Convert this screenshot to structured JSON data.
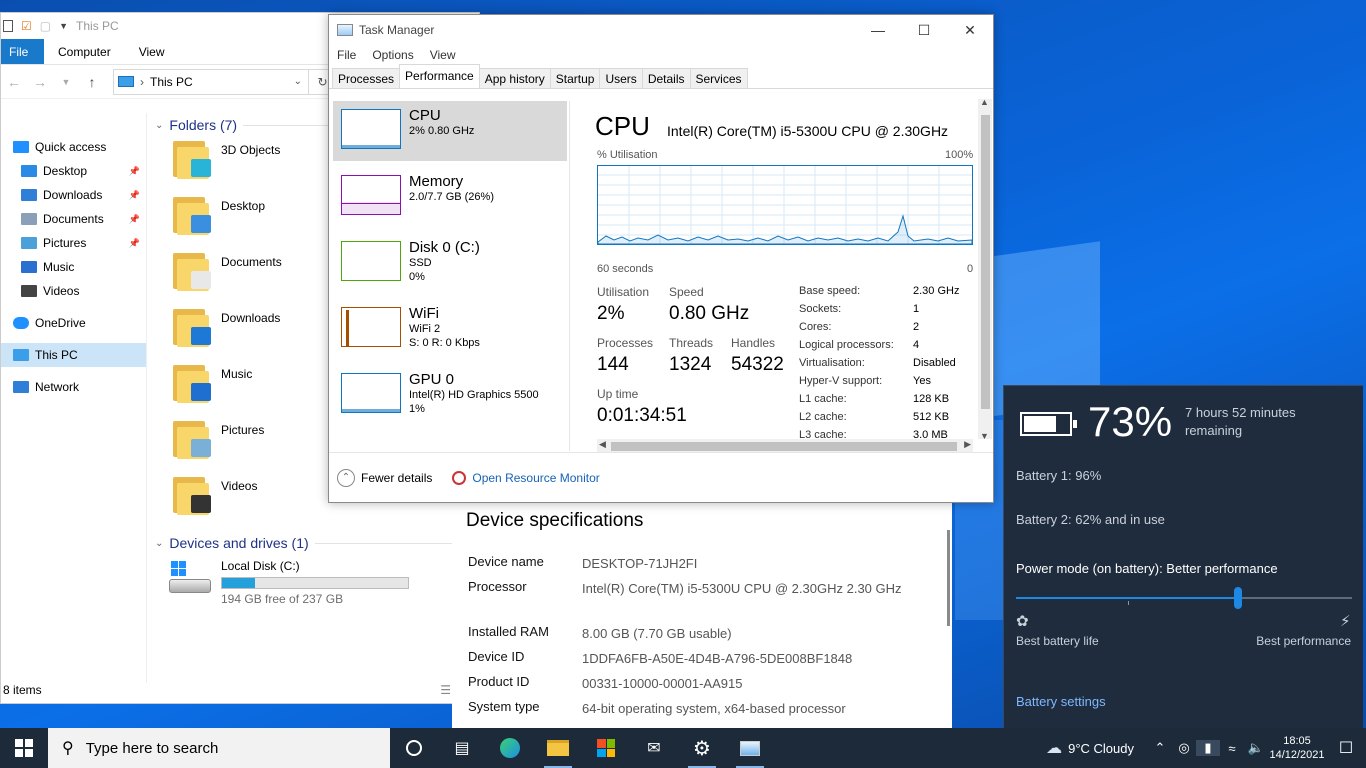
{
  "explorer": {
    "title": "This PC",
    "ribbon": {
      "file": "File",
      "computer": "Computer",
      "view": "View"
    },
    "address": "This PC",
    "nav": [
      {
        "label": "Quick access",
        "icon": "star-icon",
        "level": 0
      },
      {
        "label": "Desktop",
        "icon": "desktop-icon",
        "level": 1,
        "pinned": true
      },
      {
        "label": "Downloads",
        "icon": "downloads-icon",
        "level": 1,
        "pinned": true
      },
      {
        "label": "Documents",
        "icon": "documents-icon",
        "level": 1,
        "pinned": true
      },
      {
        "label": "Pictures",
        "icon": "pictures-icon",
        "level": 1,
        "pinned": true
      },
      {
        "label": "Music",
        "icon": "music-icon",
        "level": 1
      },
      {
        "label": "Videos",
        "icon": "videos-icon",
        "level": 1
      },
      {
        "label": "OneDrive",
        "icon": "cloud-icon",
        "level": 0
      },
      {
        "label": "This PC",
        "icon": "computer-icon",
        "level": 0,
        "selected": true
      },
      {
        "label": "Network",
        "icon": "network-icon",
        "level": 0
      }
    ],
    "folders_header": "Folders (7)",
    "folders": [
      "3D Objects",
      "Desktop",
      "Documents",
      "Downloads",
      "Music",
      "Pictures",
      "Videos"
    ],
    "drives_header": "Devices and drives (1)",
    "drive": {
      "name": "Local Disk (C:)",
      "free": "194 GB free of 237 GB",
      "used_fraction": 0.18
    },
    "status": "8 items"
  },
  "about": {
    "heading": "Device specifications",
    "rows": [
      {
        "k": "Device name",
        "v": "DESKTOP-71JH2FI"
      },
      {
        "k": "Processor",
        "v": "Intel(R) Core(TM) i5-5300U CPU @ 2.30GHz   2.30 GHz"
      },
      {
        "k": "Installed RAM",
        "v": "8.00 GB (7.70 GB usable)"
      },
      {
        "k": "Device ID",
        "v": "1DDFA6FB-A50E-4D4B-A796-5DE008BF1848"
      },
      {
        "k": "Product ID",
        "v": "00331-10000-00001-AA915"
      },
      {
        "k": "System type",
        "v": "64-bit operating system, x64-based processor"
      }
    ]
  },
  "taskmgr": {
    "title": "Task Manager",
    "menu": [
      "File",
      "Options",
      "View"
    ],
    "tabs": [
      "Processes",
      "Performance",
      "App history",
      "Startup",
      "Users",
      "Details",
      "Services"
    ],
    "perf_items": [
      {
        "name": "CPU",
        "l1": "2%  0.80 GHz",
        "l2": "",
        "l3": ""
      },
      {
        "name": "Memory",
        "l1": "2.0/7.7 GB (26%)",
        "l2": "",
        "l3": ""
      },
      {
        "name": "Disk 0 (C:)",
        "l1": "SSD",
        "l2": "0%",
        "l3": ""
      },
      {
        "name": "WiFi",
        "l1": "WiFi 2",
        "l2": "S: 0  R: 0 Kbps",
        "l3": ""
      },
      {
        "name": "GPU 0",
        "l1": "Intel(R) HD Graphics 5500",
        "l2": "1%",
        "l3": ""
      }
    ],
    "cpu": {
      "heading": "CPU",
      "model": "Intel(R) Core(TM) i5-5300U CPU @ 2.30GHz",
      "util_label": "% Utilisation",
      "util_max": "100%",
      "time_label": "60 seconds",
      "time_min": "0",
      "utilisation_label": "Utilisation",
      "utilisation": "2%",
      "speed_label": "Speed",
      "speed": "0.80 GHz",
      "processes_label": "Processes",
      "processes": "144",
      "threads_label": "Threads",
      "threads": "1324",
      "handles_label": "Handles",
      "handles": "54322",
      "uptime_label": "Up time",
      "uptime": "0:01:34:51",
      "specs": [
        {
          "k": "Base speed:",
          "v": "2.30 GHz"
        },
        {
          "k": "Sockets:",
          "v": "1"
        },
        {
          "k": "Cores:",
          "v": "2"
        },
        {
          "k": "Logical processors:",
          "v": "4"
        },
        {
          "k": "Virtualisation:",
          "v": "Disabled"
        },
        {
          "k": "Hyper-V support:",
          "v": "Yes"
        },
        {
          "k": "L1 cache:",
          "v": "128 KB"
        },
        {
          "k": "L2 cache:",
          "v": "512 KB"
        },
        {
          "k": "L3 cache:",
          "v": "3.0 MB"
        }
      ]
    },
    "footer": {
      "fewer": "Fewer details",
      "monitor": "Open Resource Monitor"
    },
    "colors": {
      "cpu": "#1176c2",
      "memory": "#8b12ae",
      "disk": "#4da60c",
      "wifi": "#a74f01",
      "gpu": "#1176c2"
    }
  },
  "battery": {
    "percent": "73%",
    "remaining": "7 hours 52 minutes remaining",
    "b1": "Battery 1: 96%",
    "b2": "Battery 2: 62% and in use",
    "mode": "Power mode (on battery): Better performance",
    "slider_level": 0.66,
    "left_label": "Best battery life",
    "right_label": "Best performance",
    "settings": "Battery settings"
  },
  "taskbar": {
    "search_placeholder": "Type here to search",
    "weather": "9°C  Cloudy",
    "time": "18:05",
    "date": "14/12/2021"
  }
}
